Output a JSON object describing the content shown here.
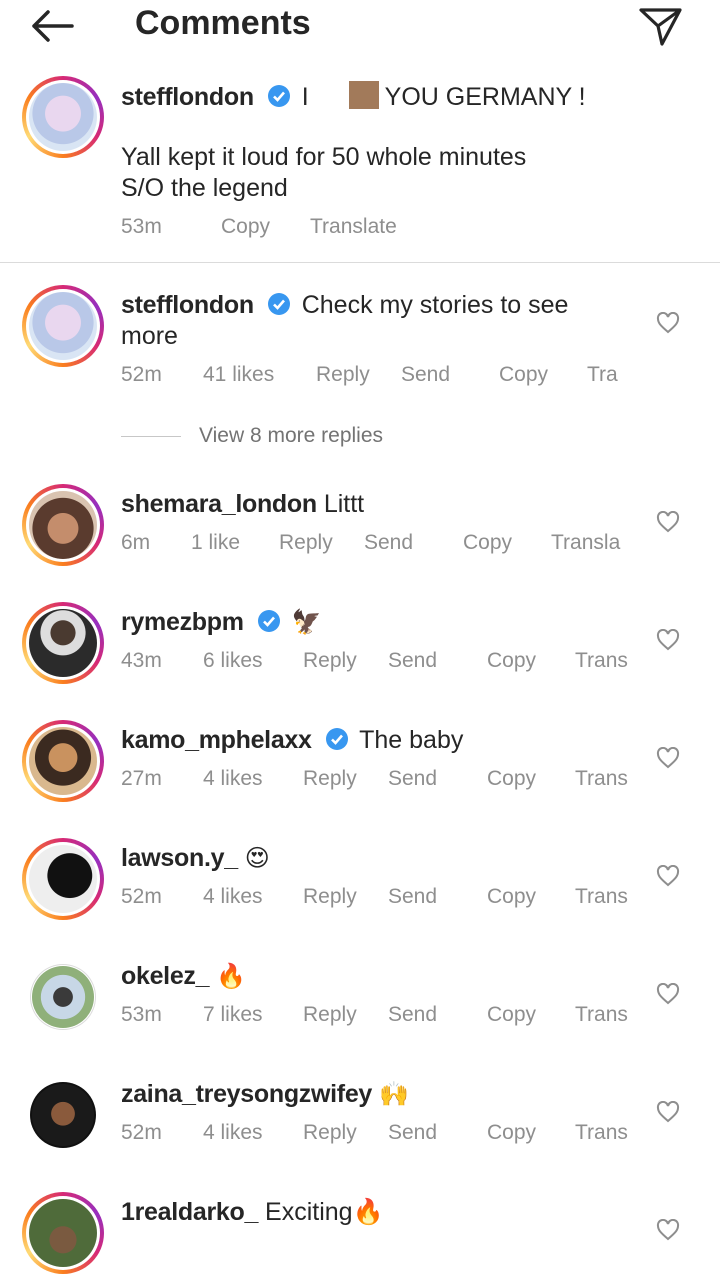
{
  "header": {
    "title": "Comments"
  },
  "post": {
    "username": "stefflondon",
    "text_part1": "I",
    "text_part2": "YOU GERMANY !",
    "text_line2": "Yall kept it loud for 50 whole minutes",
    "text_line3": "S/O the legend",
    "time": "53m",
    "copy": "Copy",
    "translate": "Translate"
  },
  "pinned_reply": {
    "username": "stefflondon",
    "text_line1": "Check my stories to see",
    "text_line2": "more",
    "time": "52m",
    "likes": "41 likes",
    "reply": "Reply",
    "send": "Send",
    "copy": "Copy",
    "translate": "Tra"
  },
  "view_more": "View 8 more replies",
  "comments": [
    {
      "username": "shemara_london",
      "text": "Littt",
      "time": "6m",
      "likes": "1 like",
      "reply": "Reply",
      "send": "Send",
      "copy": "Copy",
      "translate": "Transla"
    },
    {
      "username": "rymezbpm",
      "text": "🦅",
      "time": "43m",
      "likes": "6 likes",
      "reply": "Reply",
      "send": "Send",
      "copy": "Copy",
      "translate": "Trans"
    },
    {
      "username": "kamo_mphelaxx",
      "text": "The baby",
      "time": "27m",
      "likes": "4 likes",
      "reply": "Reply",
      "send": "Send",
      "copy": "Copy",
      "translate": "Trans"
    },
    {
      "username": "lawson.y_",
      "text": "😍",
      "time": "52m",
      "likes": "4 likes",
      "reply": "Reply",
      "send": "Send",
      "copy": "Copy",
      "translate": "Trans"
    },
    {
      "username": "okelez_",
      "text": "🔥",
      "time": "53m",
      "likes": "7 likes",
      "reply": "Reply",
      "send": "Send",
      "copy": "Copy",
      "translate": "Trans"
    },
    {
      "username": "zaina_treysongzwifey",
      "text": "🙌",
      "time": "52m",
      "likes": "4 likes",
      "reply": "Reply",
      "send": "Send",
      "copy": "Copy",
      "translate": "Trans"
    },
    {
      "username": "1realdarko_",
      "text": "Exciting🔥"
    }
  ],
  "colors": {
    "verified": "#3897f0",
    "meta": "#8e8e8e",
    "text": "#262626"
  }
}
